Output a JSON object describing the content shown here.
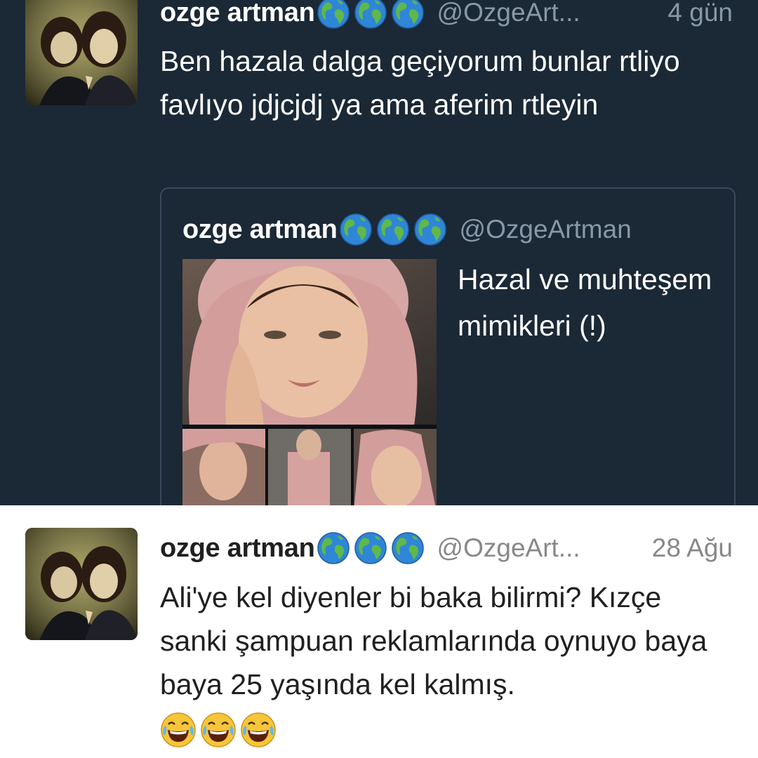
{
  "top_tweet": {
    "author_name": "ozge artman",
    "author_handle": "@OzgeArt...",
    "timestamp": "4 gün",
    "text": "Ben hazala dalga geçiyorum bunlar rtliyo favlıyo jdjcjdj ya ama aferim rtleyin",
    "avatar_icon": "avatar-photo-two-girls",
    "name_emojis": [
      "globe-icon",
      "globe-icon",
      "globe-icon"
    ],
    "quoted_tweet": {
      "author_name": "ozge artman",
      "author_handle": "@OzgeArtman",
      "text": "Hazal ve muhteşem mimikleri (!)",
      "media": [
        "main-face-photo",
        "thumb-1",
        "thumb-2",
        "thumb-3"
      ]
    }
  },
  "bottom_tweet": {
    "author_name": "ozge artman",
    "author_handle": "@OzgeArt...",
    "timestamp": "28 Ağu",
    "text": "Ali'ye kel diyenler bi baka bilirmi? Kızçe sanki şampuan reklamlarında oynuyo baya baya 25 yaşında kel kalmış.",
    "emojis": [
      "laughing-tears-icon",
      "laughing-tears-icon",
      "laughing-tears-icon"
    ]
  },
  "colors": {
    "dark_background": "#1b2836",
    "light_background": "#ffffff",
    "secondary_text_dark": "#8899a6",
    "secondary_text_light": "#888888"
  }
}
